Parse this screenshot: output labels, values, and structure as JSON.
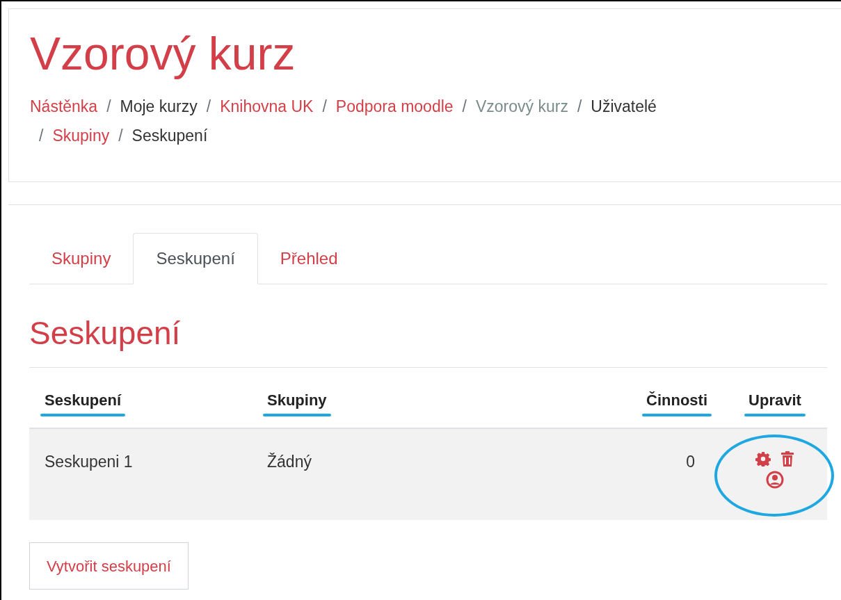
{
  "page": {
    "title": "Vzorový kurz"
  },
  "breadcrumb_separator": "/",
  "breadcrumb": [
    {
      "label": "Nástěnka",
      "kind": "link"
    },
    {
      "label": "Moje kurzy",
      "kind": "plain"
    },
    {
      "label": "Knihovna UK",
      "kind": "link"
    },
    {
      "label": "Podpora moodle",
      "kind": "link"
    },
    {
      "label": "Vzorový kurz",
      "kind": "muted"
    },
    {
      "label": "Uživatelé",
      "kind": "plain"
    },
    {
      "label": "Skupiny",
      "kind": "link"
    },
    {
      "label": "Seskupení",
      "kind": "plain"
    }
  ],
  "tabs": [
    {
      "label": "Skupiny",
      "selected": false
    },
    {
      "label": "Seskupení",
      "selected": true
    },
    {
      "label": "Přehled",
      "selected": false
    }
  ],
  "heading": "Seskupení",
  "table": {
    "columns": [
      {
        "label": "Seskupení",
        "highlighted": true
      },
      {
        "label": "Skupiny",
        "highlighted": true
      },
      {
        "label": "Činnosti",
        "highlighted": true
      },
      {
        "label": "Upravit",
        "highlighted": true
      }
    ],
    "rows": [
      {
        "name": "Seskupeni 1",
        "groups": "Žádný",
        "activities": "0",
        "actions_highlighted": true
      }
    ]
  },
  "button": "Vytvořit seskupení"
}
